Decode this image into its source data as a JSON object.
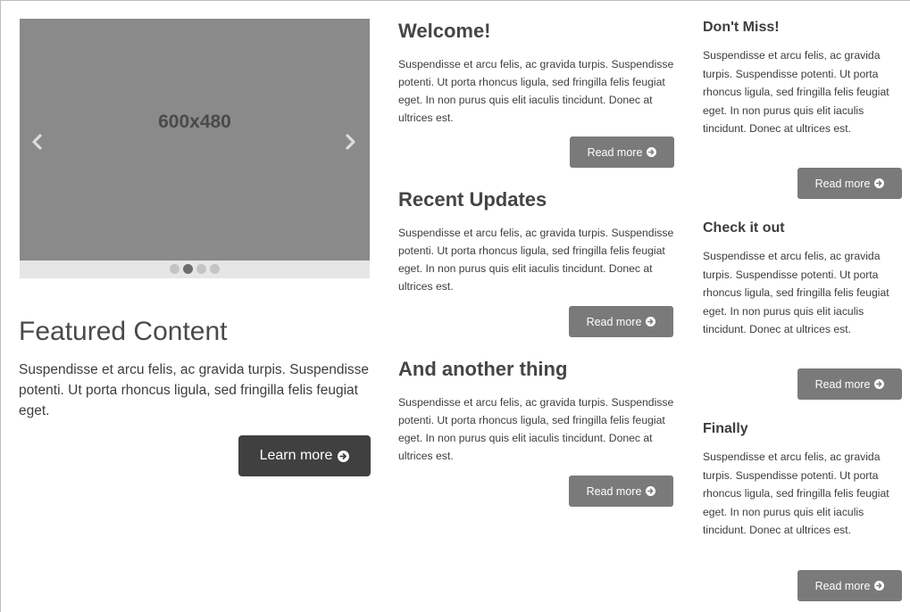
{
  "carousel": {
    "image_label": "600x480",
    "prev_icon": "chevron-left-icon",
    "next_icon": "chevron-right-icon",
    "dots_count": 4,
    "active_dot": 1
  },
  "featured": {
    "title": "Featured Content",
    "body": "Suspendisse et arcu felis, ac gravida turpis. Suspendisse potenti. Ut porta rhoncus ligula, sed fringilla felis feugiat eget.",
    "button_label": "Learn more"
  },
  "middle": [
    {
      "title": "Welcome!",
      "body": "Suspendisse et arcu felis, ac gravida turpis. Suspendisse potenti. Ut porta rhoncus ligula, sed fringilla felis feugiat eget. In non purus quis elit iaculis tincidunt. Donec at ultrices est.",
      "button_label": "Read more"
    },
    {
      "title": "Recent Updates",
      "body": "Suspendisse et arcu felis, ac gravida turpis. Suspendisse potenti. Ut porta rhoncus ligula, sed fringilla felis feugiat eget. In non purus quis elit iaculis tincidunt. Donec at ultrices est.",
      "button_label": "Read more"
    },
    {
      "title": "And another thing",
      "body": "Suspendisse et arcu felis, ac gravida turpis. Suspendisse potenti. Ut porta rhoncus ligula, sed fringilla felis feugiat eget. In non purus quis elit iaculis tincidunt. Donec at ultrices est.",
      "button_label": "Read more"
    }
  ],
  "right": [
    {
      "title": "Don't Miss!",
      "body": "Suspendisse et arcu felis, ac gravida turpis. Suspendisse potenti. Ut porta rhoncus ligula, sed fringilla felis feugiat eget. In non purus quis elit iaculis tincidunt. Donec at ultrices est.",
      "button_label": "Read more"
    },
    {
      "title": "Check it out",
      "body": "Suspendisse et arcu felis, ac gravida turpis. Suspendisse potenti. Ut porta rhoncus ligula, sed fringilla felis feugiat eget. In non purus quis elit iaculis tincidunt. Donec at ultrices est.",
      "button_label": "Read more"
    },
    {
      "title": "Finally",
      "body": "Suspendisse et arcu felis, ac gravida turpis. Suspendisse potenti. Ut porta rhoncus ligula, sed fringilla felis feugiat eget. In non purus quis elit iaculis tincidunt. Donec at ultrices est.",
      "button_label": "Read more"
    }
  ],
  "icons": {
    "button_icon": "circle-arrow-right-icon"
  },
  "colors": {
    "carousel_bg": "#8a8a8a",
    "dark_button": "#404040",
    "read_button": "#7a7a7a"
  }
}
